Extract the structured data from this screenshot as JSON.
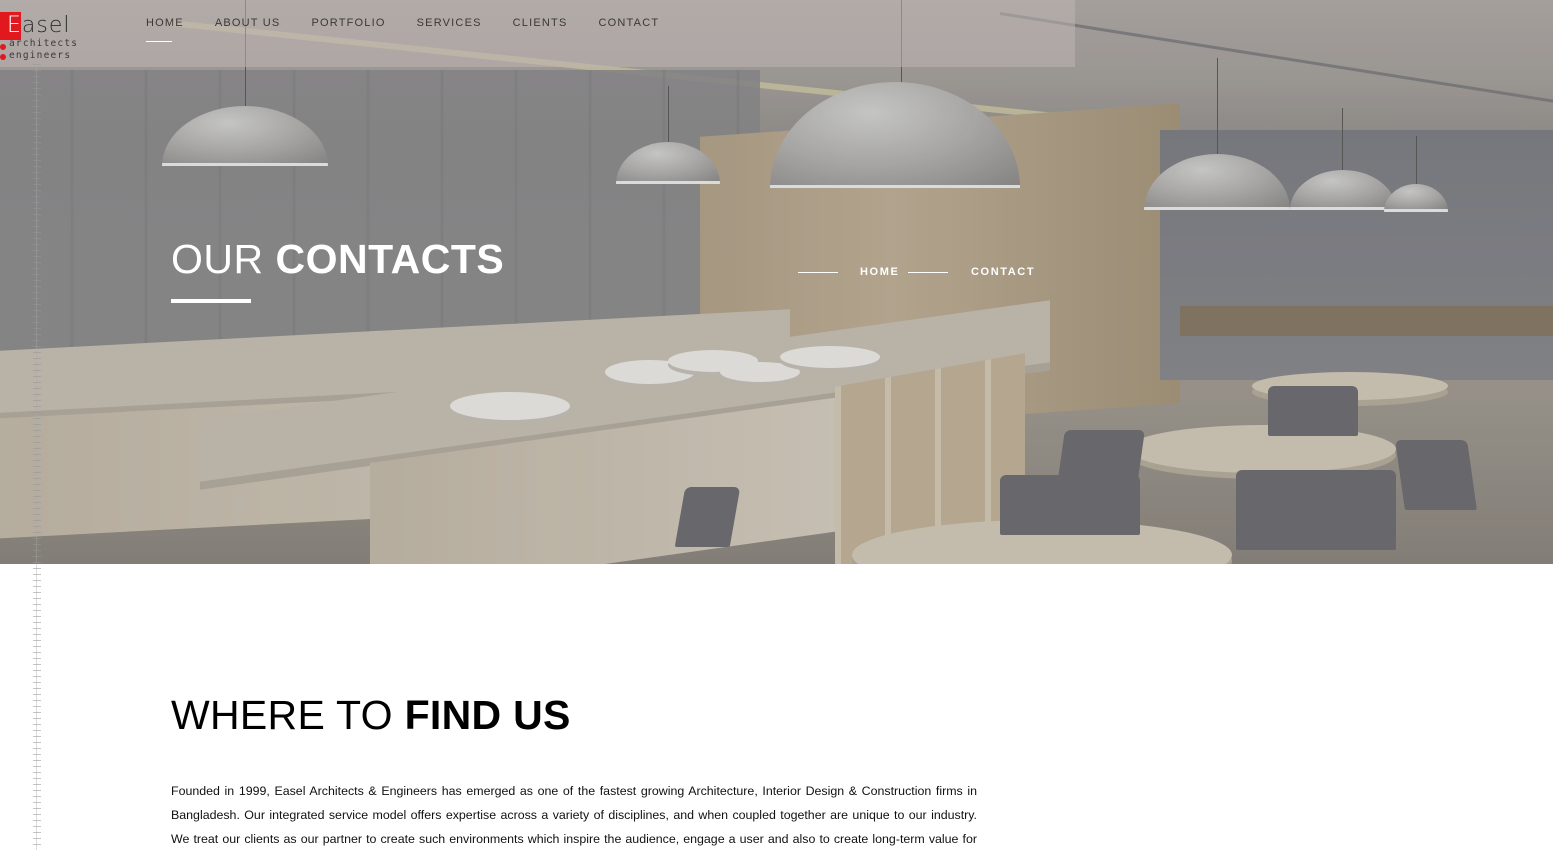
{
  "logo": {
    "first_letter": "E",
    "rest": "asel",
    "line1": "architects",
    "line2": "engineers",
    "brand_color": "#e1191e"
  },
  "nav": {
    "items": [
      {
        "label": "HOME",
        "active": true
      },
      {
        "label": "ABOUT US",
        "active": false
      },
      {
        "label": "PORTFOLIO",
        "active": false
      },
      {
        "label": "SERVICES",
        "active": false
      },
      {
        "label": "CLIENTS",
        "active": false
      },
      {
        "label": "CONTACT",
        "active": false
      }
    ]
  },
  "hero": {
    "title_light": "OUR",
    "title_bold": "CONTACTS",
    "breadcrumb": [
      "HOME",
      "CONTACT"
    ],
    "background_icon": "office-cafeteria-photo"
  },
  "section": {
    "title_light": "WHERE TO",
    "title_bold": "FIND US",
    "body": "Founded in 1999, Easel Architects & Engineers has emerged as one of the fastest growing Architecture, Interior Design & Construction firms in Bangladesh. Our integrated service model offers expertise across a variety of disciplines, and when coupled together are unique to our industry. We treat our clients as our partner to create such environments which inspire the audience, engage a user and also to create long-term value for all"
  }
}
